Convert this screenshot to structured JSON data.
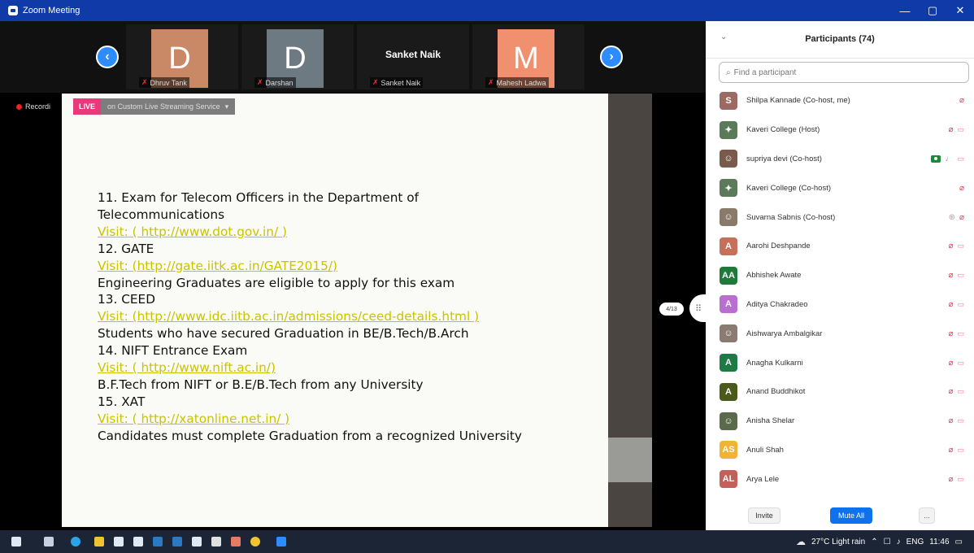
{
  "window": {
    "title": "Zoom Meeting",
    "controls": [
      "—",
      "▢",
      "✕"
    ]
  },
  "gallery": {
    "prev_icon": "‹",
    "next_icon": "›",
    "tiles": [
      {
        "avatar_letter": "D",
        "color": "#c98866",
        "name": "Dhruv Tank"
      },
      {
        "avatar_letter": "D",
        "color": "#6e7a82",
        "name": "Darshan"
      },
      {
        "avatar_letter": "",
        "color": "#1a1a1a",
        "center_name": "Sanket Naik",
        "name": "Sanket Naik"
      },
      {
        "avatar_letter": "M",
        "color": "#f0906e",
        "name": "Mahesh Ladwa"
      }
    ]
  },
  "recording": {
    "label": "Recordi"
  },
  "live": {
    "badge": "LIVE",
    "service": "on Custom Live Streaming Service",
    "dropdown_icon": "▾"
  },
  "slide": {
    "lines": [
      {
        "text": "11. Exam for Telecom Officers in the Department of",
        "type": "text"
      },
      {
        "text": "Telecommunications",
        "type": "text"
      },
      {
        "text": "Visit: ( http://www.dot.gov.in/ )",
        "type": "link"
      },
      {
        "text": "12. GATE",
        "type": "text"
      },
      {
        "text": "Visit: (http://gate.iitk.ac.in/GATE2015/)",
        "type": "link"
      },
      {
        "text": "Engineering Graduates are eligible to apply for this exam",
        "type": "text"
      },
      {
        "text": "13. CEED",
        "type": "text"
      },
      {
        "text": "Visit: (http://www.idc.iitb.ac.in/admissions/ceed-details.html )",
        "type": "link"
      },
      {
        "text": "Students who have secured Graduation in BE/B.Tech/B.Arch",
        "type": "text"
      },
      {
        "text": "14. NIFT Entrance Exam",
        "type": "text"
      },
      {
        "text": "Visit: ( http://www.nift.ac.in/)",
        "type": "link"
      },
      {
        "text": "B.F.Tech from NIFT or B.E/B.Tech from any University",
        "type": "text"
      },
      {
        "text": "15. XAT",
        "type": "text"
      },
      {
        "text": "Visit: ( http://xatonline.net.in/ )",
        "type": "link"
      },
      {
        "text": "Candidates must complete Graduation from a recognized University",
        "type": "text"
      }
    ]
  },
  "page_indicator": "4/13",
  "participants": {
    "title": "Participants (74)",
    "search_placeholder": "Find a participant",
    "list": [
      {
        "initials": "S",
        "color": "#9c6a63",
        "name": "Shilpa Kannade (Co-host, me)",
        "icons": [
          "mic-off"
        ]
      },
      {
        "initials": "✦",
        "color": "#5a7a5a",
        "name": "Kaveri College (Host)",
        "icons": [
          "mic-off",
          "cam-off"
        ]
      },
      {
        "initials": "☺",
        "color": "#7a5b4b",
        "name": "supriya devi (Co-host)",
        "icons": [
          "cam-on",
          "mic-on",
          "cam-off"
        ]
      },
      {
        "initials": "✦",
        "color": "#5a7a5a",
        "name": "Kaveri College (Co-host)",
        "icons": [
          "mic-off"
        ]
      },
      {
        "initials": "☺",
        "color": "#8a7a6a",
        "name": "Suvarna Sabnis (Co-host)",
        "icons": [
          "raise",
          "mic-off"
        ]
      },
      {
        "initials": "A",
        "color": "#c4705a",
        "name": "Aarohi Deshpande",
        "icons": [
          "mic-off",
          "cam-off"
        ]
      },
      {
        "initials": "AA",
        "color": "#1f7a3a",
        "name": "Abhishek Awate",
        "icons": [
          "mic-off",
          "cam-off"
        ]
      },
      {
        "initials": "A",
        "color": "#b86fd0",
        "name": "Aditya Chakradeo",
        "icons": [
          "mic-off",
          "cam-off"
        ]
      },
      {
        "initials": "☺",
        "color": "#8a7a72",
        "name": "Aishwarya Ambalgikar",
        "icons": [
          "mic-off",
          "cam-off"
        ]
      },
      {
        "initials": "A",
        "color": "#1d7a45",
        "name": "Anagha Kulkarni",
        "icons": [
          "mic-off",
          "cam-off"
        ]
      },
      {
        "initials": "A",
        "color": "#4a5a1a",
        "name": "Anand Buddhikot",
        "icons": [
          "mic-off",
          "cam-off"
        ]
      },
      {
        "initials": "☺",
        "color": "#5a6a4a",
        "name": "Anisha Shelar",
        "icons": [
          "mic-off",
          "cam-off"
        ]
      },
      {
        "initials": "AS",
        "color": "#f2b233",
        "name": "Anuli Shah",
        "icons": [
          "mic-off",
          "cam-off"
        ]
      },
      {
        "initials": "AL",
        "color": "#c4605a",
        "name": "Arya Lele",
        "icons": [
          "mic-off",
          "cam-off"
        ]
      }
    ],
    "invite_label": "Invite",
    "mute_all_label": "Mute All",
    "more_label": "..."
  },
  "taskbar": {
    "weather": "27°C  Light rain",
    "lang": "ENG",
    "time": "11:46"
  }
}
